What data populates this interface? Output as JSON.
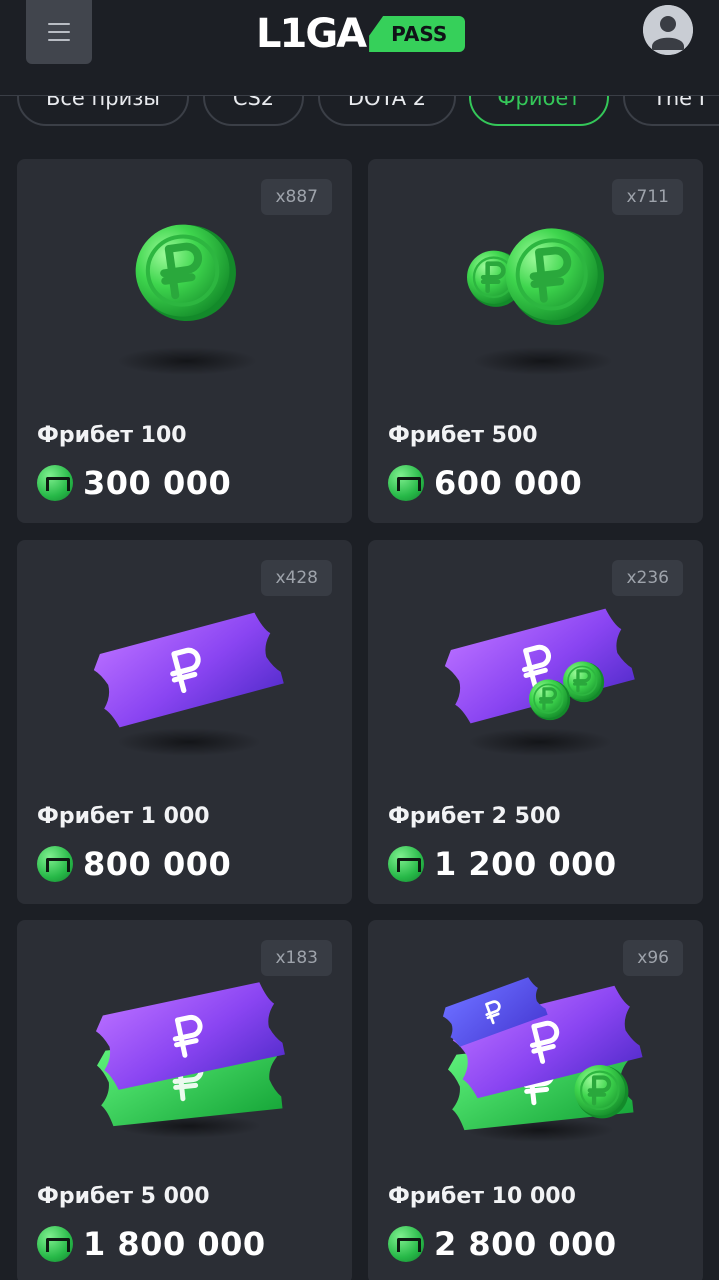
{
  "header": {
    "logo_text": "L1GA",
    "logo_badge": "PASS"
  },
  "filters": [
    {
      "label": "Все призы",
      "active": false
    },
    {
      "label": "CS2",
      "active": false
    },
    {
      "label": "DOTA 2",
      "active": false
    },
    {
      "label": "Фрибет",
      "active": true
    },
    {
      "label": "The I",
      "active": false
    }
  ],
  "products": [
    {
      "title": "Фрибет 100",
      "price": "300 000",
      "count": "x887",
      "art": "single-coin"
    },
    {
      "title": "Фрибет 500",
      "price": "600 000",
      "count": "x711",
      "art": "two-coins"
    },
    {
      "title": "Фрибет 1 000",
      "price": "800 000",
      "count": "x428",
      "art": "purple-ticket"
    },
    {
      "title": "Фрибет 2 500",
      "price": "1 200 000",
      "count": "x236",
      "art": "ticket-with-coins"
    },
    {
      "title": "Фрибет 5 000",
      "price": "1 800 000",
      "count": "x183",
      "art": "two-tickets"
    },
    {
      "title": "Фрибет 10 000",
      "price": "2 800 000",
      "count": "x96",
      "art": "tickets-with-coin"
    }
  ],
  "icons": {
    "menu": "hamburger-icon",
    "profile": "user-avatar-icon",
    "currency": "liga-coin-icon"
  },
  "colors": {
    "background": "#1c1f25",
    "card": "#2b2e35",
    "accent_green": "#36d05a",
    "ticket_purple": "#8b46f0"
  }
}
